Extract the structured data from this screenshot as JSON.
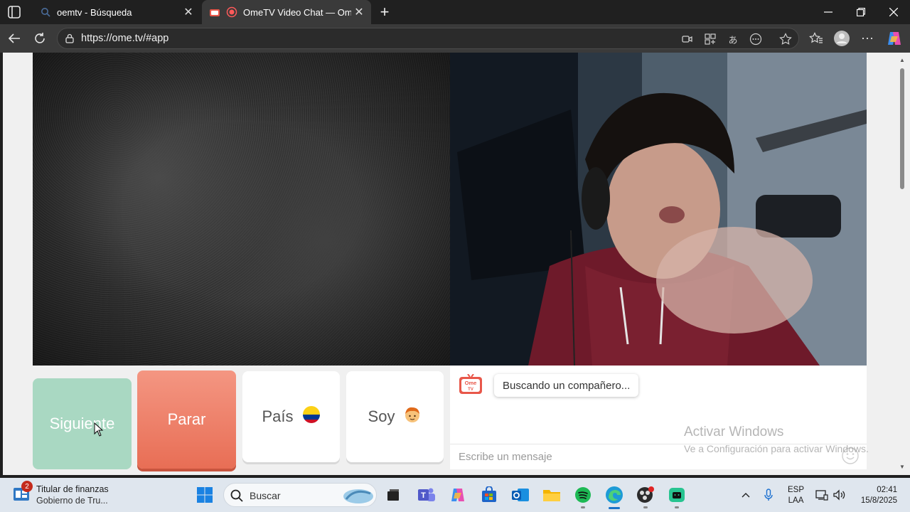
{
  "browser": {
    "tabs": [
      {
        "title": "oemtv - Búsqueda",
        "favicon": "search-icon",
        "active": false
      },
      {
        "title": "OmeTV Video Chat — Omeg",
        "favicon": "record-icon",
        "active": true
      }
    ],
    "url": "https://ome.tv/#app"
  },
  "app": {
    "buttons": {
      "next": "Siguiente",
      "stop": "Parar",
      "country": "País",
      "gender": "Soy"
    },
    "chat": {
      "logo_text_1": "Ome",
      "logo_text_2": "TV",
      "status_message": "Buscando un compañero...",
      "input_placeholder": "Escribe un mensaje"
    },
    "colors": {
      "next_button": "#a9d8c2",
      "stop_button": "#e86e55"
    }
  },
  "watermark": {
    "title": "Activar Windows",
    "subtitle": "Ve a Configuración para activar Windows."
  },
  "taskbar": {
    "widget": {
      "badge": "2",
      "line1": "Titular de finanzas",
      "line2": "Gobierno de Tru..."
    },
    "search_placeholder": "Buscar",
    "language_line1": "ESP",
    "language_line2": "LAA",
    "time": "02:41",
    "date": "15/8/2025"
  }
}
